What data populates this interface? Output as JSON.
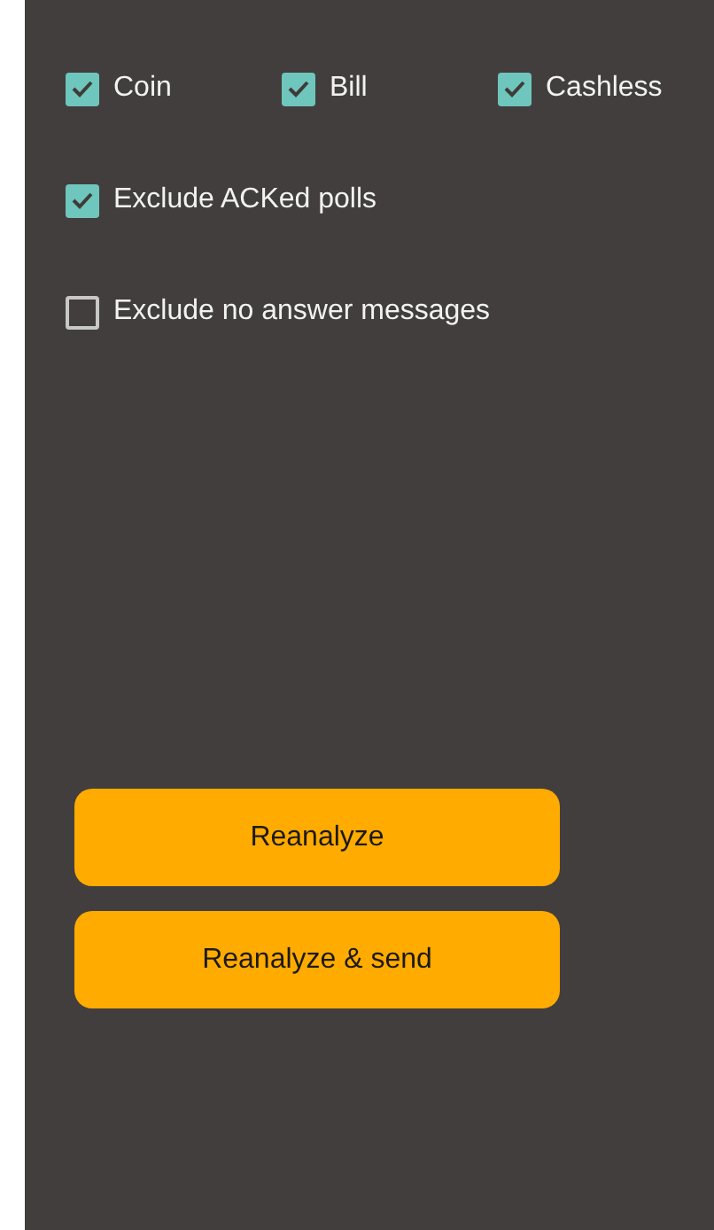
{
  "payment_types": [
    {
      "label": "Coin",
      "checked": true
    },
    {
      "label": "Bill",
      "checked": true
    },
    {
      "label": "Cashless",
      "checked": true
    }
  ],
  "options": [
    {
      "label": "Exclude ACKed polls",
      "checked": true
    },
    {
      "label": "Exclude no answer messages",
      "checked": false
    }
  ],
  "buttons": [
    "Reanalyze",
    "Reanalyze & send"
  ]
}
